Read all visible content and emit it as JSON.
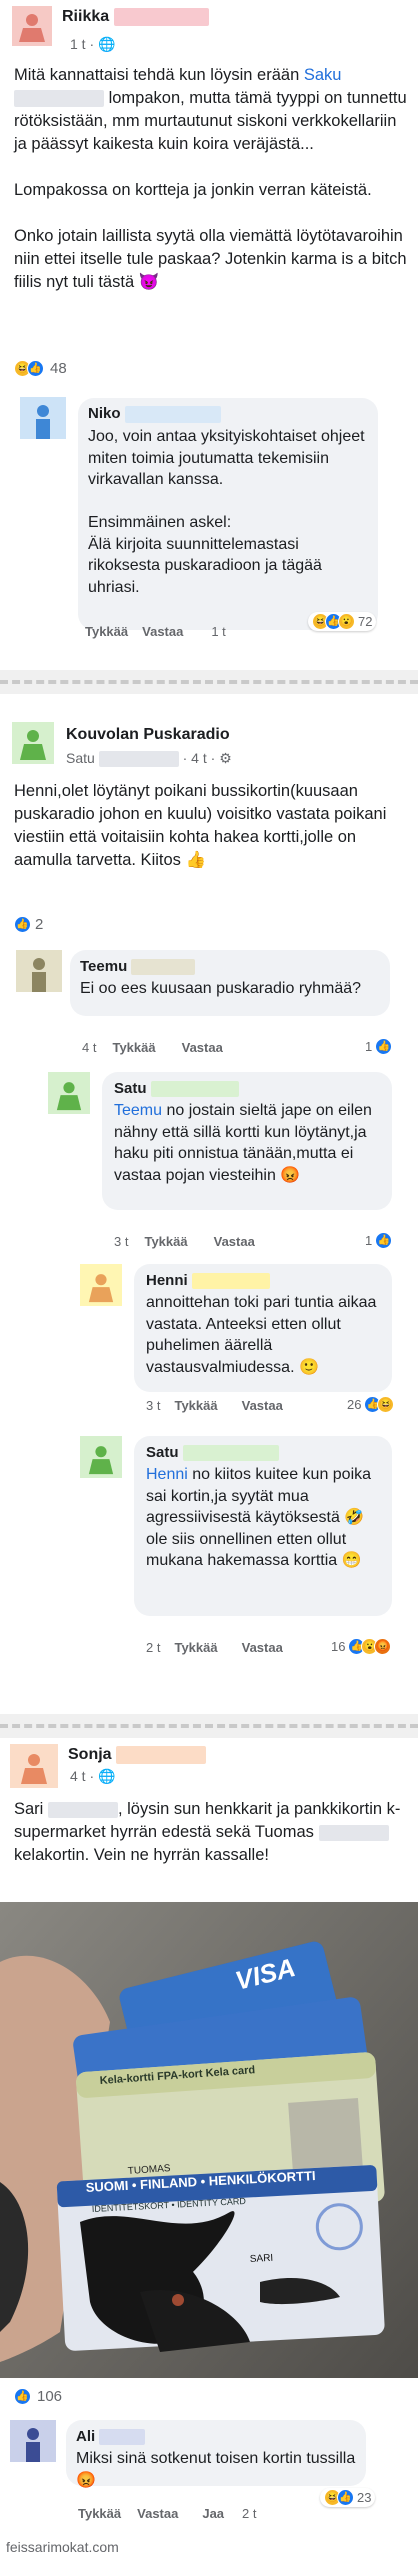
{
  "post1": {
    "author": "Riikka",
    "time": "1 t",
    "text_html_parts": {
      "p1a": "Mitä kannattaisi tehdä kun löysin erään ",
      "p1_link": "Saku",
      "p1b": "lompakon, mutta tämä tyyppi on tunnettu rötöksistään, mm murtautunut siskoni verkkokellariin ja päässyt kaikesta kuin koira veräjästä...",
      "p2": "Lompakossa on kortteja ja jonkin verran käteistä.",
      "p3": "Onko jotain laillista syytä olla viemättä löytötavaroihin niin ettei itselle tule paskaa? Jotenkin karma is a bitch fiilis nyt tuli tästä 😈"
    },
    "reaction_count": "48",
    "comment": {
      "author": "Niko",
      "text1": "Joo, voin antaa yksityiskohtaiset ohjeet miten toimia joutumatta tekemisiin virkavallan kanssa.",
      "text2": "Ensimmäinen askel:",
      "text3": "Älä kirjoita suunnittelemastasi rikoksesta puskaradioon ja tägää uhriasi.",
      "actions": [
        "Tykkää",
        "Vastaa",
        "1 t"
      ],
      "reaction_count": "72"
    }
  },
  "post2": {
    "group": "Kouvolan Puskaradio",
    "author": "Satu",
    "time": "4 t",
    "text": "Henni,olet löytänyt poikani bussikortin(kuusaan puskaradio johon en kuulu) voisitko vastata poikani viestiin että voitaisiin kohta hakea kortti,jolle on aamulla tarvetta. Kiitos 👍",
    "reaction_count": "2",
    "comments": [
      {
        "author": "Teemu",
        "text": "Ei oo ees kuusaan puskaradio ryhmää?",
        "actions": [
          "4 t",
          "Tykkää",
          "Vastaa"
        ],
        "reaction_count": "1"
      },
      {
        "author": "Satu",
        "mention": "Teemu",
        "text": " no jostain sieltä jape on eilen nähny että sillä kortti kun löytänyt,ja haku piti onnistua tänään,mutta ei vastaa pojan viesteihin 😡",
        "actions": [
          "3 t",
          "Tykkää",
          "Vastaa"
        ],
        "reaction_count": "1"
      },
      {
        "author": "Henni",
        "text": "annoittehan toki pari tuntia aikaa vastata. Anteeksi etten ollut puhelimen äärellä vastausvalmiudessa. 🙂",
        "actions": [
          "3 t",
          "Tykkää",
          "Vastaa"
        ],
        "reaction_count": "26"
      },
      {
        "author": "Satu",
        "mention": "Henni",
        "text": " no kiitos kuitee kun poika sai kortin,ja syytät mua agressiivisestä käytöksestä 🤣 ole siis onnellinen etten ollut mukana hakemassa korttia 😁",
        "actions": [
          "2 t",
          "Tykkää",
          "Vastaa"
        ],
        "reaction_count": "16"
      }
    ]
  },
  "post3": {
    "author": "Sonja",
    "time": "4 t",
    "text_a": "Sari",
    "text_b": ", löysin sun henkkarit ja pankkikortin k-supermarket hyrrän edestä sekä Tuomas",
    "text_c": "kelakortin. Vein ne hyrrän kassalle!",
    "photo_cards": {
      "visa": "VISA",
      "kela_title": "Kela-kortti  FPA-kort  Kela card",
      "kela_name": "TUOMAS",
      "id_title": "SUOMI • FINLAND • HENKILÖKORTTI",
      "id_sub": "IDENTITETSKORT • IDENTITY CARD",
      "id_name": "SARI"
    },
    "reaction_count": "106",
    "comment": {
      "author": "Ali",
      "text": "Miksi sinä sotkenut toisen kortin tussilla 😡",
      "actions": [
        "Tykkää",
        "Vastaa",
        "Jaa",
        "2 t"
      ],
      "reaction_count": "23"
    }
  },
  "footer": "feissarimokat.com",
  "colors": {
    "link": "#216fdb",
    "like": "#1877f2",
    "avatar_pink": "#f6c9c5",
    "avatar_blue": "#cde3f7",
    "avatar_green": "#d6f0cd",
    "avatar_olive": "#e4e0c8",
    "avatar_yellow": "#fff6b3",
    "avatar_peach": "#fbdcc7",
    "avatar_navy": "#c9d0ea"
  }
}
